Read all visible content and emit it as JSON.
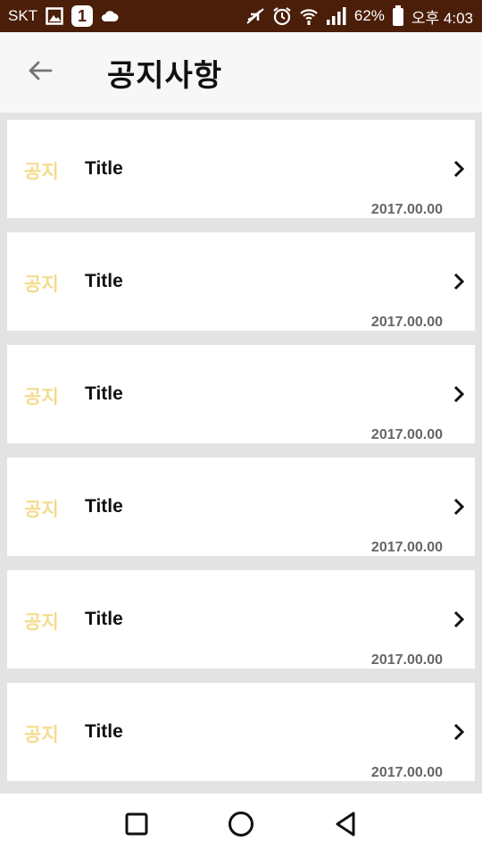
{
  "status_bar": {
    "carrier": "SKT",
    "notification_count": "1",
    "battery": "62%",
    "time": "오후 4:03"
  },
  "header": {
    "title": "공지사항"
  },
  "notices": [
    {
      "tag": "공지",
      "title": "Title",
      "date": "2017.00.00"
    },
    {
      "tag": "공지",
      "title": "Title",
      "date": "2017.00.00"
    },
    {
      "tag": "공지",
      "title": "Title",
      "date": "2017.00.00"
    },
    {
      "tag": "공지",
      "title": "Title",
      "date": "2017.00.00"
    },
    {
      "tag": "공지",
      "title": "Title",
      "date": "2017.00.00"
    },
    {
      "tag": "공지",
      "title": "Title",
      "date": "2017.00.00"
    }
  ],
  "colors": {
    "status_bar": "#4a1e08",
    "tag": "#f4dc8e",
    "header_bg": "#f7f7f7",
    "list_bg": "#e3e3e3"
  },
  "icons": {
    "back": "arrow-left-icon",
    "chevron": "chevron-right-icon",
    "nav_recent": "square-icon",
    "nav_home": "circle-icon",
    "nav_back": "triangle-back-icon"
  }
}
